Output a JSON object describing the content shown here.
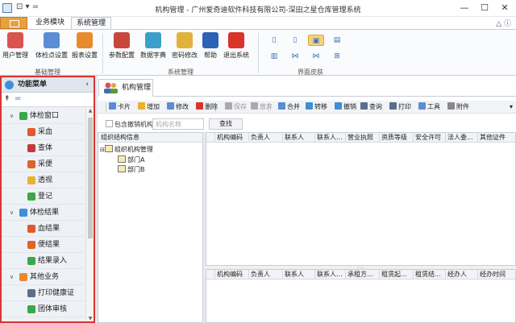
{
  "window": {
    "title": "机构管理 - 广州爱奇迪软件科技有限公司-深田之星仓库管理系统",
    "min": "—",
    "max": "☐",
    "close": "✕",
    "quick_access": "⊡ ▾ ="
  },
  "ribbon_tabs": [
    "业务模块",
    "系统管理"
  ],
  "topright": "△ ⓘ",
  "ribbon": {
    "buttons": [
      {
        "label": "用户管理",
        "icon": "users-icon",
        "color": "#d9534f"
      },
      {
        "label": "体检点设置",
        "icon": "station-icon",
        "color": "#5b8dd6"
      },
      {
        "label": "报表设置",
        "icon": "report-icon",
        "color": "#e88a2e"
      },
      {
        "label": "参数配置",
        "icon": "wrench-icon",
        "color": "#c9463d"
      },
      {
        "label": "数据字典",
        "icon": "books-icon",
        "color": "#3aa0c9"
      },
      {
        "label": "密码修改",
        "icon": "key-icon",
        "color": "#e0b33a"
      },
      {
        "label": "帮助",
        "icon": "help-icon",
        "color": "#2b62b5"
      },
      {
        "label": "退出系统",
        "icon": "exit-icon",
        "color": "#d9332a"
      }
    ],
    "groups": [
      "基础管理",
      "系统管理",
      "界面皮肤"
    ],
    "skins": [
      "▯",
      "▯",
      "▣",
      "▤",
      "▥",
      "⋈",
      "⋈",
      "⊞"
    ]
  },
  "leftpanel": {
    "title": "功能菜单",
    "collapse": "‹",
    "filter_pin": "↟",
    "filter_value": "=",
    "items": [
      {
        "label": "体检窗口",
        "level": 0,
        "expand": "∨",
        "color": "#3aa84a"
      },
      {
        "label": "采血",
        "level": 1,
        "color": "#e05a2b"
      },
      {
        "label": "查体",
        "level": 1,
        "color": "#c33b3b"
      },
      {
        "label": "采便",
        "level": 1,
        "color": "#d9662b"
      },
      {
        "label": "透视",
        "level": 1,
        "color": "#e7b32e"
      },
      {
        "label": "登记",
        "level": 1,
        "color": "#3aa84a"
      },
      {
        "label": "体检结果",
        "level": 0,
        "expand": "∨",
        "color": "#3d8fd8"
      },
      {
        "label": "血结果",
        "level": 1,
        "color": "#e05a2b"
      },
      {
        "label": "便结果",
        "level": 1,
        "color": "#d9662b"
      },
      {
        "label": "结果录入",
        "level": 1,
        "color": "#3aa84a"
      },
      {
        "label": "其他业务",
        "level": 0,
        "expand": "∨",
        "color": "#e88a2e"
      },
      {
        "label": "打印健康证",
        "level": 1,
        "color": "#5b6f8a"
      },
      {
        "label": "团体审核",
        "level": 1,
        "color": "#3aa84a"
      }
    ]
  },
  "main": {
    "tab": "机构管理",
    "toolbar": [
      {
        "label": "卡片",
        "color": "#5b8dd6",
        "enabled": true
      },
      {
        "label": "增加",
        "color": "#e7b32e",
        "enabled": true
      },
      {
        "label": "修改",
        "color": "#5b8dd6",
        "enabled": true
      },
      {
        "label": "删除",
        "color": "#d9332a",
        "enabled": true
      },
      {
        "label": "保存",
        "color": "#aaaaaa",
        "enabled": false
      },
      {
        "label": "放弃",
        "color": "#aaaaaa",
        "enabled": false
      },
      {
        "label": "合并",
        "color": "#5b8dd6",
        "enabled": true
      },
      {
        "label": "转移",
        "color": "#3d8fd8",
        "enabled": true
      },
      {
        "label": "撤销",
        "color": "#3d8fd8",
        "enabled": true
      },
      {
        "label": "查询",
        "color": "#5b6f8a",
        "enabled": true
      },
      {
        "label": "打印",
        "color": "#5b6f8a",
        "enabled": true
      },
      {
        "label": "工具",
        "color": "#5b8dd6",
        "enabled": true
      },
      {
        "label": "附件",
        "color": "#888888",
        "enabled": true
      }
    ],
    "include_cancelled": "包含撤销机构",
    "search_placeholder": "机构名称",
    "search_button": "查找",
    "org_header": "组织结构信息",
    "org_root": "组织机构管理",
    "org_children": [
      "部门A",
      "部门B"
    ],
    "grid1_columns": [
      "机构编码",
      "负责人",
      "联系人",
      "联系人...",
      "营业执照",
      "资质等级",
      "安全许可",
      "法人委...",
      "其他证件"
    ],
    "grid2_columns": [
      "机构编码",
      "负责人",
      "联系人",
      "联系人...",
      "承租方...",
      "租赁起...",
      "租赁结...",
      "经办人",
      "经办时间"
    ],
    "splitter": "....."
  }
}
